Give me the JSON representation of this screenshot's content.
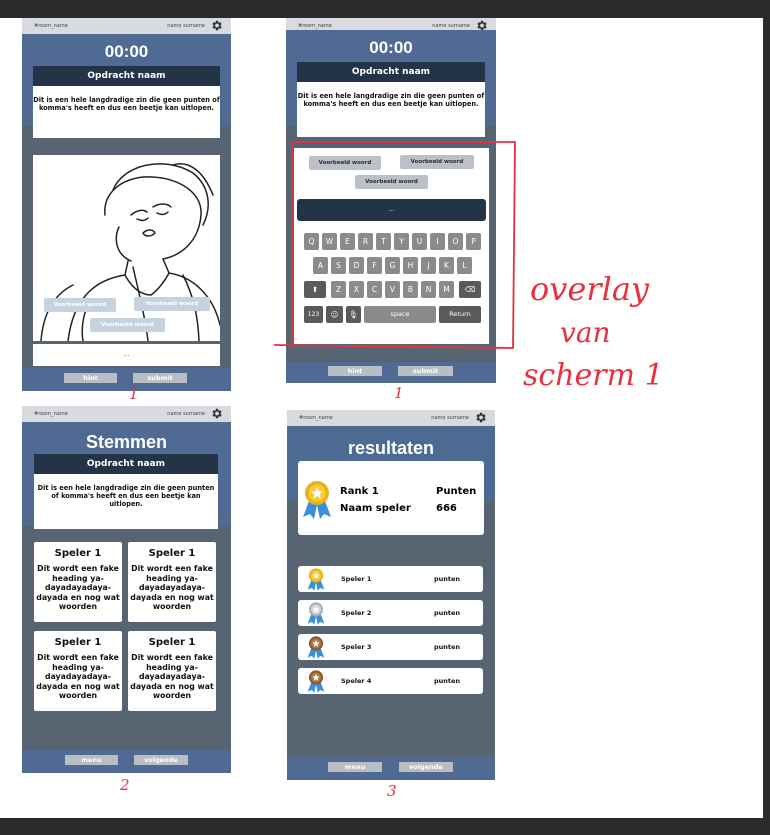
{
  "common": {
    "room": "#room_name",
    "user": "name surname",
    "task_title": "Opdracht naam",
    "task_text": "Dit is een hele langdradige zin die geen punten of komma's heeft en dus een beetje kan uitlopen."
  },
  "screen1": {
    "timer": "00:00",
    "words": [
      "Voorbeeld woord",
      "Voorbeeld woord",
      "Voorbeeld woord"
    ],
    "input": "...",
    "hint": "hint",
    "submit": "submit",
    "number": "1"
  },
  "screen1b": {
    "timer": "00:00",
    "words": [
      "Voorbeeld woord",
      "Voorbeeld woord",
      "Voorbeeld woord"
    ],
    "input": "...",
    "keys_row1": [
      "Q",
      "W",
      "E",
      "R",
      "T",
      "Y",
      "U",
      "I",
      "O",
      "P"
    ],
    "keys_row2": [
      "A",
      "S",
      "D",
      "F",
      "G",
      "H",
      "J",
      "K",
      "L"
    ],
    "keys_row3": [
      "Z",
      "X",
      "C",
      "V",
      "B",
      "N",
      "M"
    ],
    "key_123": "123",
    "key_space": "space",
    "key_return": "Return",
    "hint": "hint",
    "submit": "submit",
    "number": "1"
  },
  "screen2": {
    "title": "Stemmen",
    "cards": [
      {
        "name": "Speler 1",
        "text": "Dit wordt een fake heading ya-dayadayadaya-dayada en nog wat woorden"
      },
      {
        "name": "Speler 1",
        "text": "Dit wordt een fake heading ya-dayadayadaya-dayada en nog wat woorden"
      },
      {
        "name": "Speler 1",
        "text": "Dit wordt een fake heading ya-dayadayadaya-dayada en nog wat woorden"
      },
      {
        "name": "Speler 1",
        "text": "Dit wordt een fake heading ya-dayadayadaya-dayada en nog wat woorden"
      }
    ],
    "menu": "menu",
    "next": "volgende",
    "number": "2"
  },
  "screen3": {
    "title": "resultaten",
    "rank_label": "Rank 1",
    "name_label": "Naam speler",
    "points_label": "Punten",
    "points_value": "666",
    "rows": [
      {
        "name": "Speler 1",
        "points": "punten",
        "medal": "gold-medal-icon"
      },
      {
        "name": "Speler 2",
        "points": "punten",
        "medal": "silver-medal-icon"
      },
      {
        "name": "Speler 3",
        "points": "punten",
        "medal": "bronze-medal-icon"
      },
      {
        "name": "Speler 4",
        "points": "punten",
        "medal": "bronze-medal-icon"
      }
    ],
    "menu": "menu",
    "next": "volgende",
    "number": "3"
  },
  "annotation": {
    "line1": "overlay",
    "line2": "van",
    "line3": "scherm 1"
  },
  "colors": {
    "band": "#4f6b94",
    "panel": "#576572",
    "dark_header": "#243447",
    "annotation_red": "#e8313f"
  }
}
